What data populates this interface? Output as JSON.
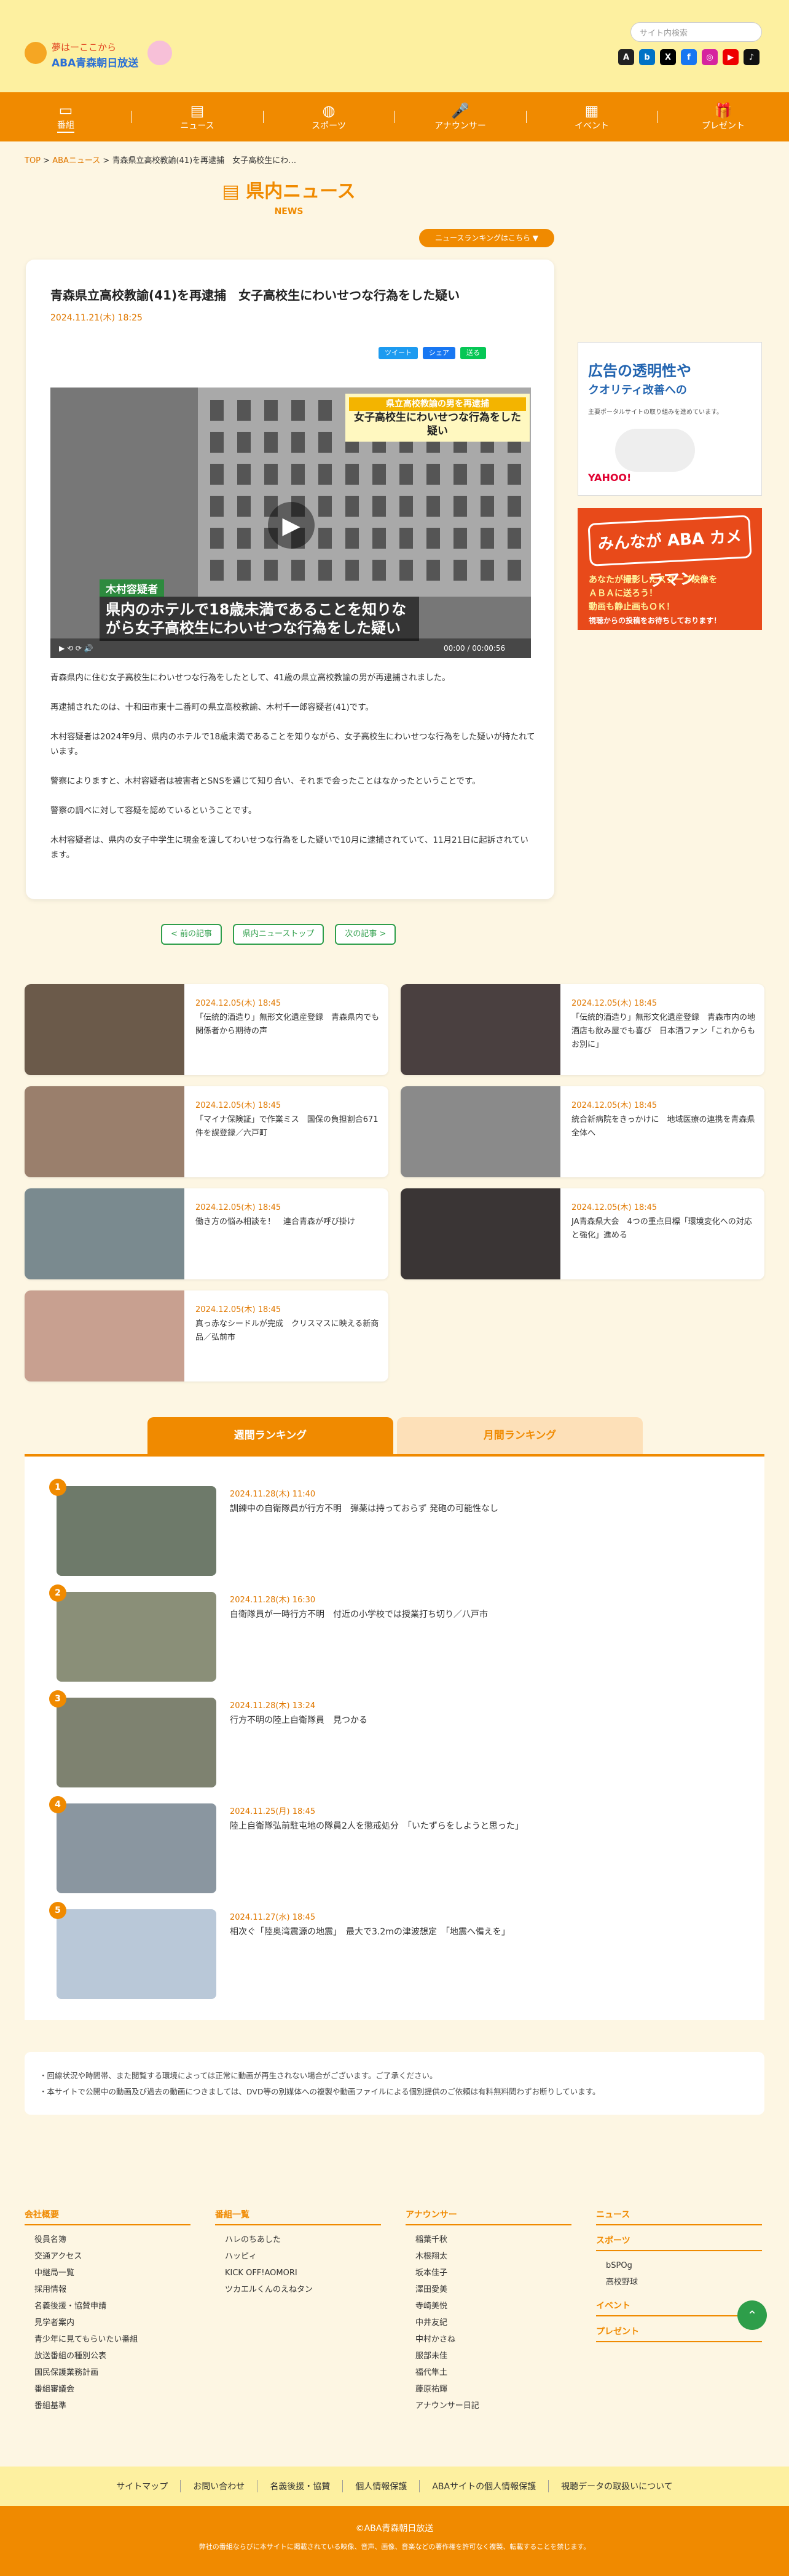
{
  "header": {
    "logo_sub": "夢はーここから",
    "logo_main": "ABA青森朝日放送",
    "search_placeholder": "サイト内検索",
    "sns": [
      "A",
      "b",
      "X",
      "f",
      "◎",
      "▶",
      "♪"
    ]
  },
  "nav": [
    {
      "icon": "▭",
      "label": "番組",
      "active": true
    },
    {
      "icon": "▤",
      "label": "ニュース"
    },
    {
      "icon": "◍",
      "label": "スポーツ"
    },
    {
      "icon": "🎤",
      "label": "アナウンサー"
    },
    {
      "icon": "▦",
      "label": "イベント"
    },
    {
      "icon": "🎁",
      "label": "プレゼント"
    }
  ],
  "breadcrumb": {
    "top": "TOP",
    "sep": ">",
    "aba": "ABAニュース",
    "current": "青森県立高校教諭(41)を再逮捕　女子高校生にわ…"
  },
  "section": {
    "title_jp": "県内ニュース",
    "title_en": "NEWS",
    "ranking_button": "ニュースランキングはこちら ▼"
  },
  "article": {
    "title": "青森県立高校教諭(41)を再逮捕　女子高校生にわいせつな行為をした疑い",
    "date": "2024.11.21(木) 18:25",
    "share": [
      "ツイート",
      "シェア",
      "送る"
    ],
    "video": {
      "tag_top": "県立高校教諭の男を再逮捕",
      "tag_bottom": "女子高校生にわいせつな行為をした疑い",
      "name_tag": "木村容疑者",
      "caption": "県内のホテルで18歳未満であることを知りながら女子高校生にわいせつな行為をした疑い",
      "time": "00:00 / 00:00:56"
    },
    "paragraphs": [
      "青森県内に住む女子高校生にわいせつな行為をしたとして、41歳の県立高校教諭の男が再逮捕されました。",
      "再逮捕されたのは、十和田市東十二番町の県立高校教諭、木村千一郎容疑者(41)です。",
      "木村容疑者は2024年9月、県内のホテルで18歳未満であることを知りながら、女子高校生にわいせつな行為をした疑いが持たれています。",
      "警察によりますと、木村容疑者は被害者とSNSを通じて知り合い、それまで会ったことはなかったということです。",
      "警察の調べに対して容疑を認めているということです。",
      "木村容疑者は、県内の女子中学生に現金を渡してわいせつな行為をした疑いで10月に逮捕されていて、11月21日に起訴されています。"
    ]
  },
  "pager": {
    "prev": "< 前の記事",
    "top": "県内ニューストップ",
    "next": "次の記事 >"
  },
  "ads": {
    "ad1_line1": "広告の透明性や",
    "ad1_line2": "クオリティ改善への",
    "ad1_sub": "主要ポータルサイトの取り組みを進めています。",
    "ad1_brand": "YAHOO!",
    "ad2_logo": "みんなが ABA カメラマン",
    "ad2_l1": "あなたが撮影したスクープ映像を",
    "ad2_l2": "ＡＢＡに送ろう！",
    "ad2_l3": "動画も静止画もＯＫ！",
    "ad2_l4": "視聴からの投稿をお待ちしております！"
  },
  "cards": [
    {
      "date": "2024.12.05(木) 18:45",
      "title": "「伝統的酒造り」無形文化遺産登録　青森県内でも関係者から期待の声"
    },
    {
      "date": "2024.12.05(木) 18:45",
      "title": "「伝統的酒造り」無形文化遺産登録　青森市内の地酒店も飲み屋でも喜び　日本酒ファン「これからもお別に」"
    },
    {
      "date": "2024.12.05(木) 18:45",
      "title": "「マイナ保険証」で作業ミス　国保の負担割合671件を誤登録／六戸町"
    },
    {
      "date": "2024.12.05(木) 18:45",
      "title": "統合新病院をきっかけに　地域医療の連携を青森県全体へ"
    },
    {
      "date": "2024.12.05(木) 18:45",
      "title": "働き方の悩み相談を！　連合青森が呼び掛け"
    },
    {
      "date": "2024.12.05(木) 18:45",
      "title": "JA青森県大会　4つの重点目標「環境変化への対応と強化」進める"
    },
    {
      "date": "2024.12.05(木) 18:45",
      "title": "真っ赤なシードルが完成　クリスマスに映える新商品／弘前市"
    }
  ],
  "ranking": {
    "tab_weekly": "週間ランキング",
    "tab_monthly": "月間ランキング",
    "items": [
      {
        "num": "1",
        "date": "2024.11.28(木) 11:40",
        "title": "訓練中の自衛隊員が行方不明　弾薬は持っておらず 発砲の可能性なし"
      },
      {
        "num": "2",
        "date": "2024.11.28(木) 16:30",
        "title": "自衛隊員が一時行方不明　付近の小学校では授業打ち切り／八戸市"
      },
      {
        "num": "3",
        "date": "2024.11.28(木) 13:24",
        "title": "行方不明の陸上自衛隊員　見つかる"
      },
      {
        "num": "4",
        "date": "2024.11.25(月) 18:45",
        "title": "陸上自衛隊弘前駐屯地の隊員2人を懲戒処分　「いたずらをしようと思った」"
      },
      {
        "num": "5",
        "date": "2024.11.27(水) 18:45",
        "title": "相次ぐ「陸奥湾震源の地震」　最大で3.2mの津波想定　「地震へ備えを」"
      }
    ]
  },
  "notice": [
    "・回線状況や時間帯、また閲覧する環境によっては正常に動画が再生されない場合がございます。ご了承ください。",
    "・本サイトで公開中の動画及び過去の動画につきましては、DVD等の別媒体への複製や動画ファイルによる個別提供のご依頼は有料無料問わずお断りしています。"
  ],
  "footer": {
    "cols": [
      {
        "title": "会社概要",
        "items": [
          "役員名簿",
          "交通アクセス",
          "中継局一覧",
          "採用情報",
          "名義後援・協賛申請",
          "見学者案内",
          "青少年に見てもらいたい番組",
          "放送番組の種別公表",
          "国民保護業務計画",
          "番組審議会",
          "番組基準"
        ]
      },
      {
        "title": "番組一覧",
        "items": [
          "ハレのちあした",
          "ハッピィ",
          "KICK OFF!AOMORI",
          "ツカエルくんのえねタン"
        ]
      },
      {
        "title": "アナウンサー",
        "items": [
          "稲葉千秋",
          "木根翔太",
          "坂本佳子",
          "澤田愛美",
          "寺崎美悦",
          "中井友紀",
          "中村かさね",
          "服部未佳",
          "福代隼土",
          "藤原祐輝",
          "アナウンサー日記"
        ]
      },
      {
        "title": "ニュース",
        "items": []
      }
    ],
    "sports_title": "スポーツ",
    "sports_items": [
      "bSPOg",
      "高校野球"
    ],
    "event_title": "イベント",
    "present_title": "プレゼント",
    "links": [
      "サイトマップ",
      "お問い合わせ",
      "名義後援・協賛",
      "個人情報保護",
      "ABAサイトの個人情報保護",
      "視聴データの取扱いについて"
    ],
    "copyright": "©ABA青森朝日放送",
    "copy_note": "弊社の番組ならびに本サイトに掲載されている映像、音声、画像、音楽などの著作権を許可なく複製、転載することを禁じます。"
  }
}
